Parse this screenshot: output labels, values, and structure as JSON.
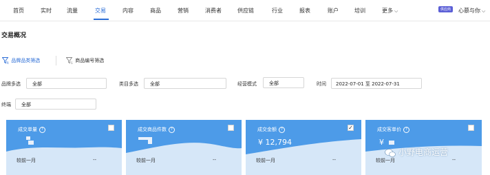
{
  "nav": {
    "items": [
      "首页",
      "实时",
      "流量",
      "交易",
      "内容",
      "商品",
      "营销",
      "消费者",
      "供应链",
      "行业",
      "报表",
      "账户",
      "培训",
      "更多"
    ],
    "active": "交易",
    "shop_badge": "供应商",
    "shop_name": "心慕与你"
  },
  "page": {
    "title": "交易概况"
  },
  "filters": {
    "category_btn": "品牌品类筛选",
    "product_code_btn": "商品编号筛选",
    "brand_label": "品牌多选",
    "brand_value": "全部",
    "category_label": "类目多选",
    "category_value": "全部",
    "mode_label": "经营模式",
    "mode_value": "全部",
    "time_label": "时间",
    "time_value": "2022-07-01 至 2022-07-31",
    "terminal_label": "终端",
    "terminal_value": "全部"
  },
  "cards": [
    {
      "title": "成交单量",
      "value": "",
      "checked": false,
      "compare_label": "较前一月",
      "compare_value": "--"
    },
    {
      "title": "成交商品件数",
      "value": "",
      "checked": false,
      "compare_label": "较前一月",
      "compare_value": "--"
    },
    {
      "title": "成交金额",
      "value": "¥ 12,794",
      "checked": true,
      "compare_label": "较前一月",
      "compare_value": "--"
    },
    {
      "title": "成交客单价",
      "value": "¥",
      "checked": false,
      "compare_label": "较前一月",
      "compare_value": "--"
    }
  ],
  "watermark": "小野电商运营",
  "colors": {
    "accent": "#2a6cd6",
    "card_bg": "#4d9be8",
    "card_wave": "#d6e7f8"
  }
}
